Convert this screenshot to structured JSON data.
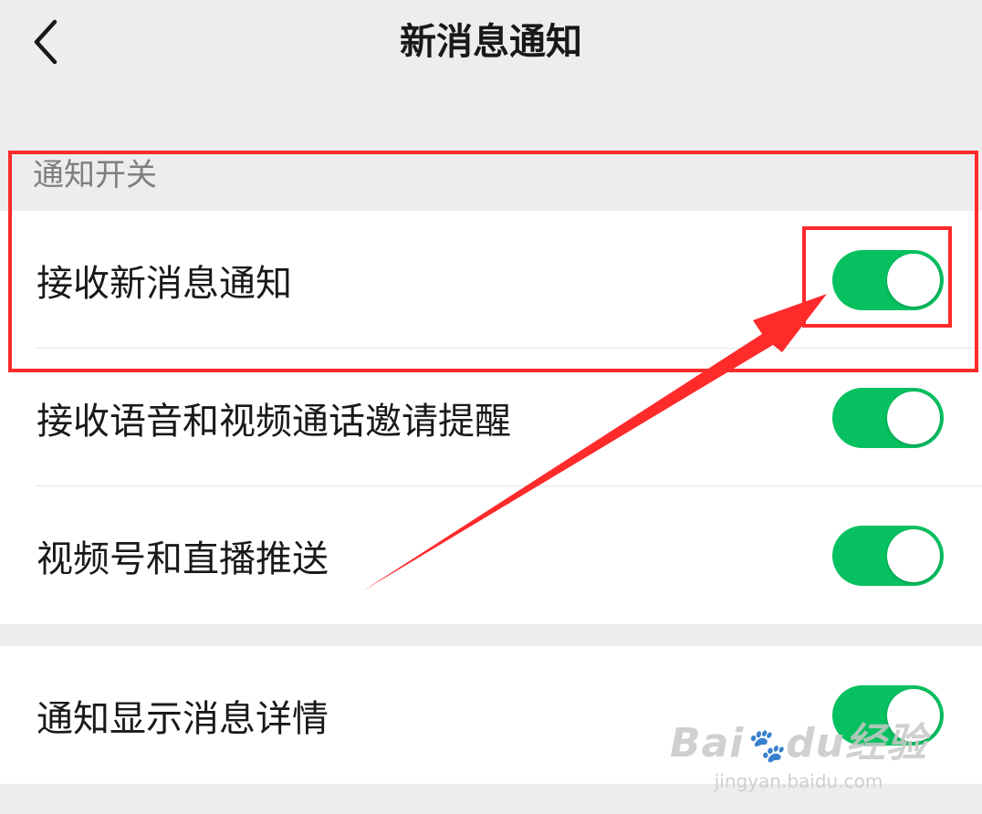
{
  "header": {
    "title": "新消息通知",
    "back_icon": "chevron-left-icon"
  },
  "section": {
    "label": "通知开关"
  },
  "group1": {
    "items": [
      {
        "label": "接收新消息通知",
        "enabled": true
      },
      {
        "label": "接收语音和视频通话邀请提醒",
        "enabled": true
      },
      {
        "label": "视频号和直播推送",
        "enabled": true
      }
    ]
  },
  "group2": {
    "items": [
      {
        "label": "通知显示消息详情",
        "enabled": true
      }
    ]
  },
  "colors": {
    "toggle_on": "#07c160",
    "annotation": "#ff2a2a",
    "background": "#ededed"
  },
  "watermark": {
    "logo": "Bai",
    "logo_tail": "du",
    "logo_cn": "经验",
    "url": "jingyan.baidu.com"
  }
}
